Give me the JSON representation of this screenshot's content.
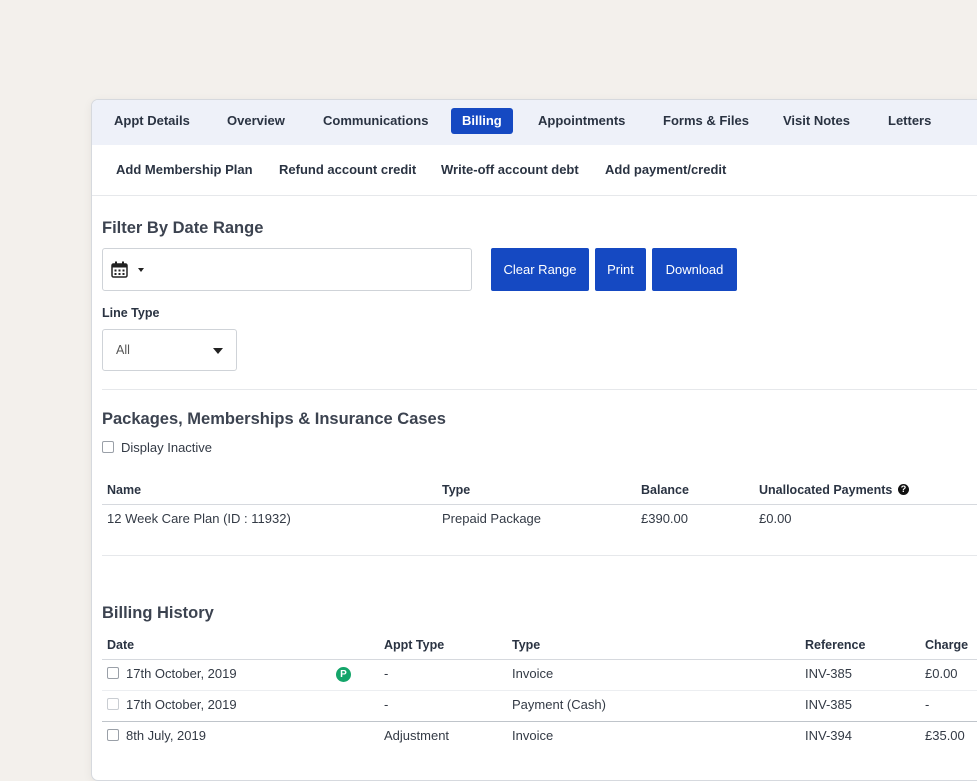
{
  "tabs": [
    {
      "label": "Appt Details"
    },
    {
      "label": "Overview"
    },
    {
      "label": "Communications"
    },
    {
      "label": "Billing"
    },
    {
      "label": "Appointments"
    },
    {
      "label": "Forms & Files"
    },
    {
      "label": "Visit Notes"
    },
    {
      "label": "Letters"
    }
  ],
  "active_tab": "Billing",
  "actions": [
    {
      "label": "Add Membership Plan"
    },
    {
      "label": "Refund account credit"
    },
    {
      "label": "Write-off account debt"
    },
    {
      "label": "Add payment/credit"
    }
  ],
  "filter": {
    "title": "Filter By Date Range",
    "date_range_value": "",
    "clear_label": "Clear Range",
    "print_label": "Print",
    "download_label": "Download",
    "line_type_label": "Line Type",
    "line_type_value": "All"
  },
  "packages": {
    "title": "Packages, Memberships & Insurance Cases",
    "display_inactive_label": "Display Inactive",
    "columns": [
      "Name",
      "Type",
      "Balance",
      "Unallocated Payments"
    ],
    "rows": [
      {
        "name": "12 Week Care Plan (ID : 11932)",
        "type": "Prepaid Package",
        "balance": "£390.00",
        "unallocated": "£0.00"
      }
    ]
  },
  "billing_history": {
    "title": "Billing History",
    "columns": [
      "Date",
      "Appt Type",
      "Type",
      "Reference",
      "Charge"
    ],
    "rows": [
      {
        "date": "17th October, 2019",
        "badge": "P",
        "appt_type": "-",
        "type": "Invoice",
        "reference": "INV-385",
        "charge": "£0.00"
      },
      {
        "date": "17th October, 2019",
        "badge": "",
        "appt_type": "-",
        "type": "Payment (Cash)",
        "reference": "INV-385",
        "charge": "-"
      },
      {
        "date": "8th July, 2019",
        "badge": "",
        "appt_type": "Adjustment",
        "type": "Invoice",
        "reference": "INV-394",
        "charge": "£35.00"
      }
    ]
  },
  "icons": {
    "calendar": "calendar-icon",
    "help": "question-circle-icon",
    "badge": "p-badge-icon"
  },
  "colors": {
    "accent": "#1549c2",
    "tab_bar": "#eef1f9",
    "badge_green": "#14a56a",
    "background": "#f3f0ec"
  }
}
